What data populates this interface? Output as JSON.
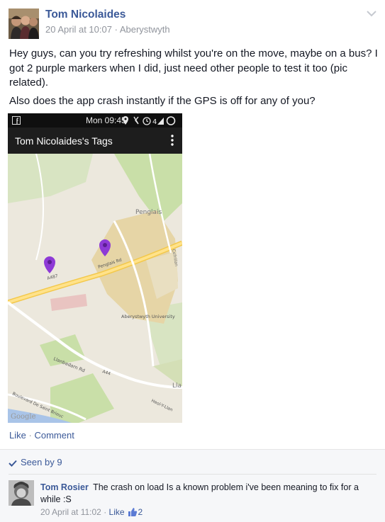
{
  "post": {
    "author": "Tom Nicolaides",
    "date": "20 April at 10:07",
    "meta_separator": "·",
    "location": "Aberystwyth",
    "paragraph1": "Hey guys, can you try refreshing whilst you're on the move, maybe on a bus? I got 2 purple markers when I did, just need other people to test it too (pic related).",
    "paragraph2": "Also does the app crash instantly if the GPS is off for any of you?"
  },
  "screenshot": {
    "status_time": "Mon 09:45",
    "app_title": "Tom Nicolaides's Tags",
    "map_labels": {
      "penglais": "Penglais",
      "penglais_rd": "Penglais Rd",
      "a487": "A487",
      "cefnllan": "Cefnllan",
      "university": "Aberystwyth University",
      "llanbadarn": "Llanbadarn Rd",
      "a44": "A44",
      "heol": "Heol-Y-Llan",
      "boulevard": "Boulevard De Saint Brieuc",
      "lla": "Lla",
      "google": "Google"
    },
    "marker_color": "#8e3ad6"
  },
  "actions": {
    "like": "Like",
    "separator": "·",
    "comment": "Comment"
  },
  "feedback": {
    "seen_by": "Seen by 9"
  },
  "comment": {
    "author": "Tom Rosier",
    "text": "The crash on load Is a known problem i've been meaning to fix for a while :S",
    "date": "20 April at 11:02",
    "separator": "·",
    "like": "Like",
    "like_count": "2"
  },
  "colors": {
    "link": "#3b5998",
    "meta": "#90949c",
    "map_road": "#f3c84a",
    "map_green": "#c9dfa8"
  }
}
